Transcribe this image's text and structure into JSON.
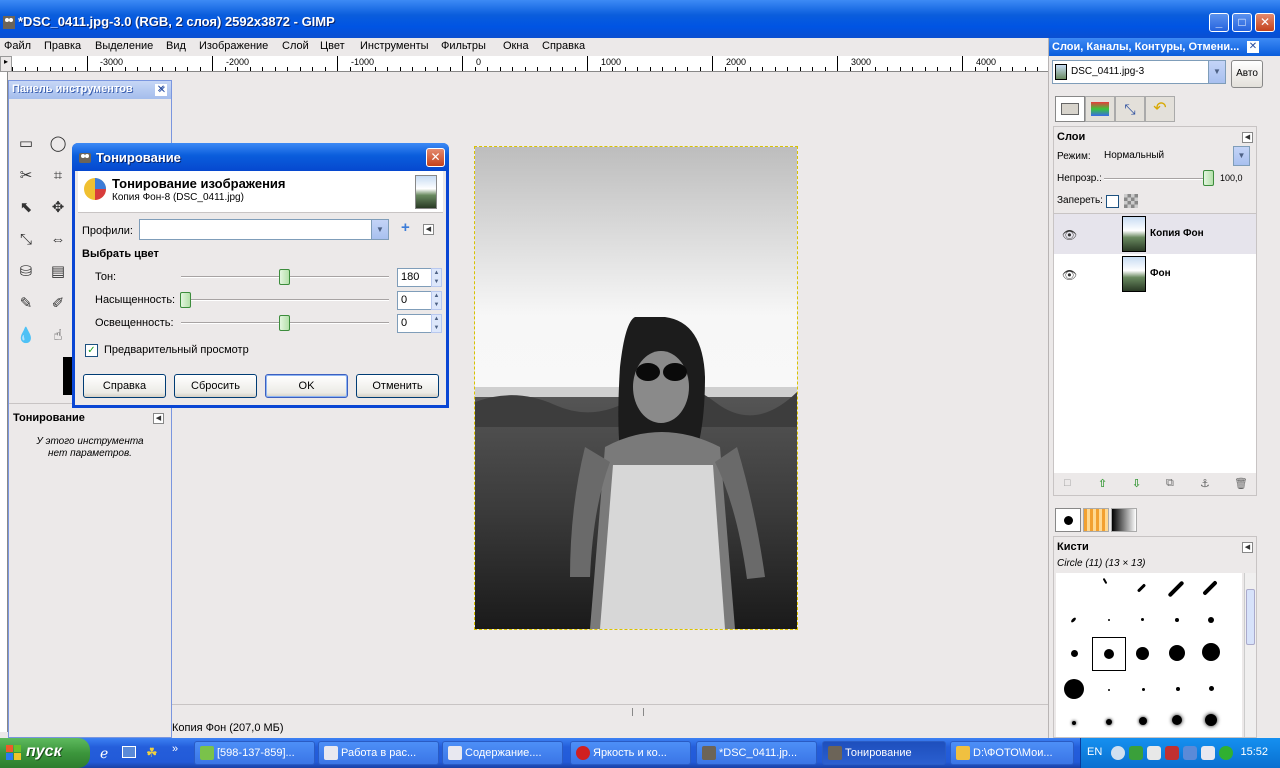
{
  "window": {
    "title": "*DSC_0411.jpg-3.0 (RGB, 2 слоя) 2592x3872 - GIMP"
  },
  "menu": [
    "Файл",
    "Правка",
    "Выделение",
    "Вид",
    "Изображение",
    "Слой",
    "Цвет",
    "Инструменты",
    "Фильтры",
    "Окна",
    "Справка"
  ],
  "ruler": {
    "labels": [
      "-3000",
      "-2000",
      "-1000",
      "0",
      "1000",
      "2000",
      "3000",
      "4000"
    ]
  },
  "status": "Копия Фон (207,0 МБ)",
  "toolbox": {
    "title": "Панель инструментов",
    "options_title": "Тонирование",
    "options_msg_1": "У этого инструмента",
    "options_msg_2": "нет параметров."
  },
  "dialog": {
    "title": "Тонирование",
    "heading": "Тонирование изображения",
    "subheading": "Копия Фон-8 (DSC_0411.jpg)",
    "profiles_label": "Профили:",
    "profiles_value": "",
    "section": "Выбрать цвет",
    "hue_label": "Тон:",
    "hue_value": "180",
    "saturation_label": "Насыщенность:",
    "saturation_value": "0",
    "lightness_label": "Освещенность:",
    "lightness_value": "0",
    "preview_label": "Предварительный просмотр",
    "preview_checked": true,
    "buttons": {
      "help": "Справка",
      "reset": "Сбросить",
      "ok": "OK",
      "cancel": "Отменить"
    },
    "slider_levels": {
      "hue": 0.5,
      "saturation": 0.0,
      "lightness": 0.5
    }
  },
  "dock": {
    "title": "Слои, Каналы, Контуры, Отмени...",
    "image_select": "DSC_0411.jpg-3",
    "auto_button": "Авто",
    "layers_title": "Слои",
    "mode_label": "Режим:",
    "mode_value": "Нормальный",
    "opacity_label": "Непрозр.:",
    "opacity_value": "100,0",
    "opacity_level": 1.0,
    "lock_label": "Запереть:",
    "layers": [
      {
        "name": "Копия Фон",
        "selected": true
      },
      {
        "name": "Фон",
        "selected": false
      }
    ],
    "brushes_title": "Кисти",
    "brush_info": "Circle (11) (13 × 13)"
  },
  "taskbar": {
    "start": "пуск",
    "tasks": [
      "[598-137-859]...",
      "Работа в рас...",
      "Содержание....",
      "Яркость и ко...",
      "*DSC_0411.jp...",
      "Тонирование",
      "D:\\ФОТО\\Мои..."
    ],
    "active_task": "Тонирование",
    "lang": "EN",
    "clock": "15:52"
  },
  "colors": {
    "xp_blue": "#0054e3",
    "start_green": "#3c963c",
    "selection": "#d9c200"
  }
}
